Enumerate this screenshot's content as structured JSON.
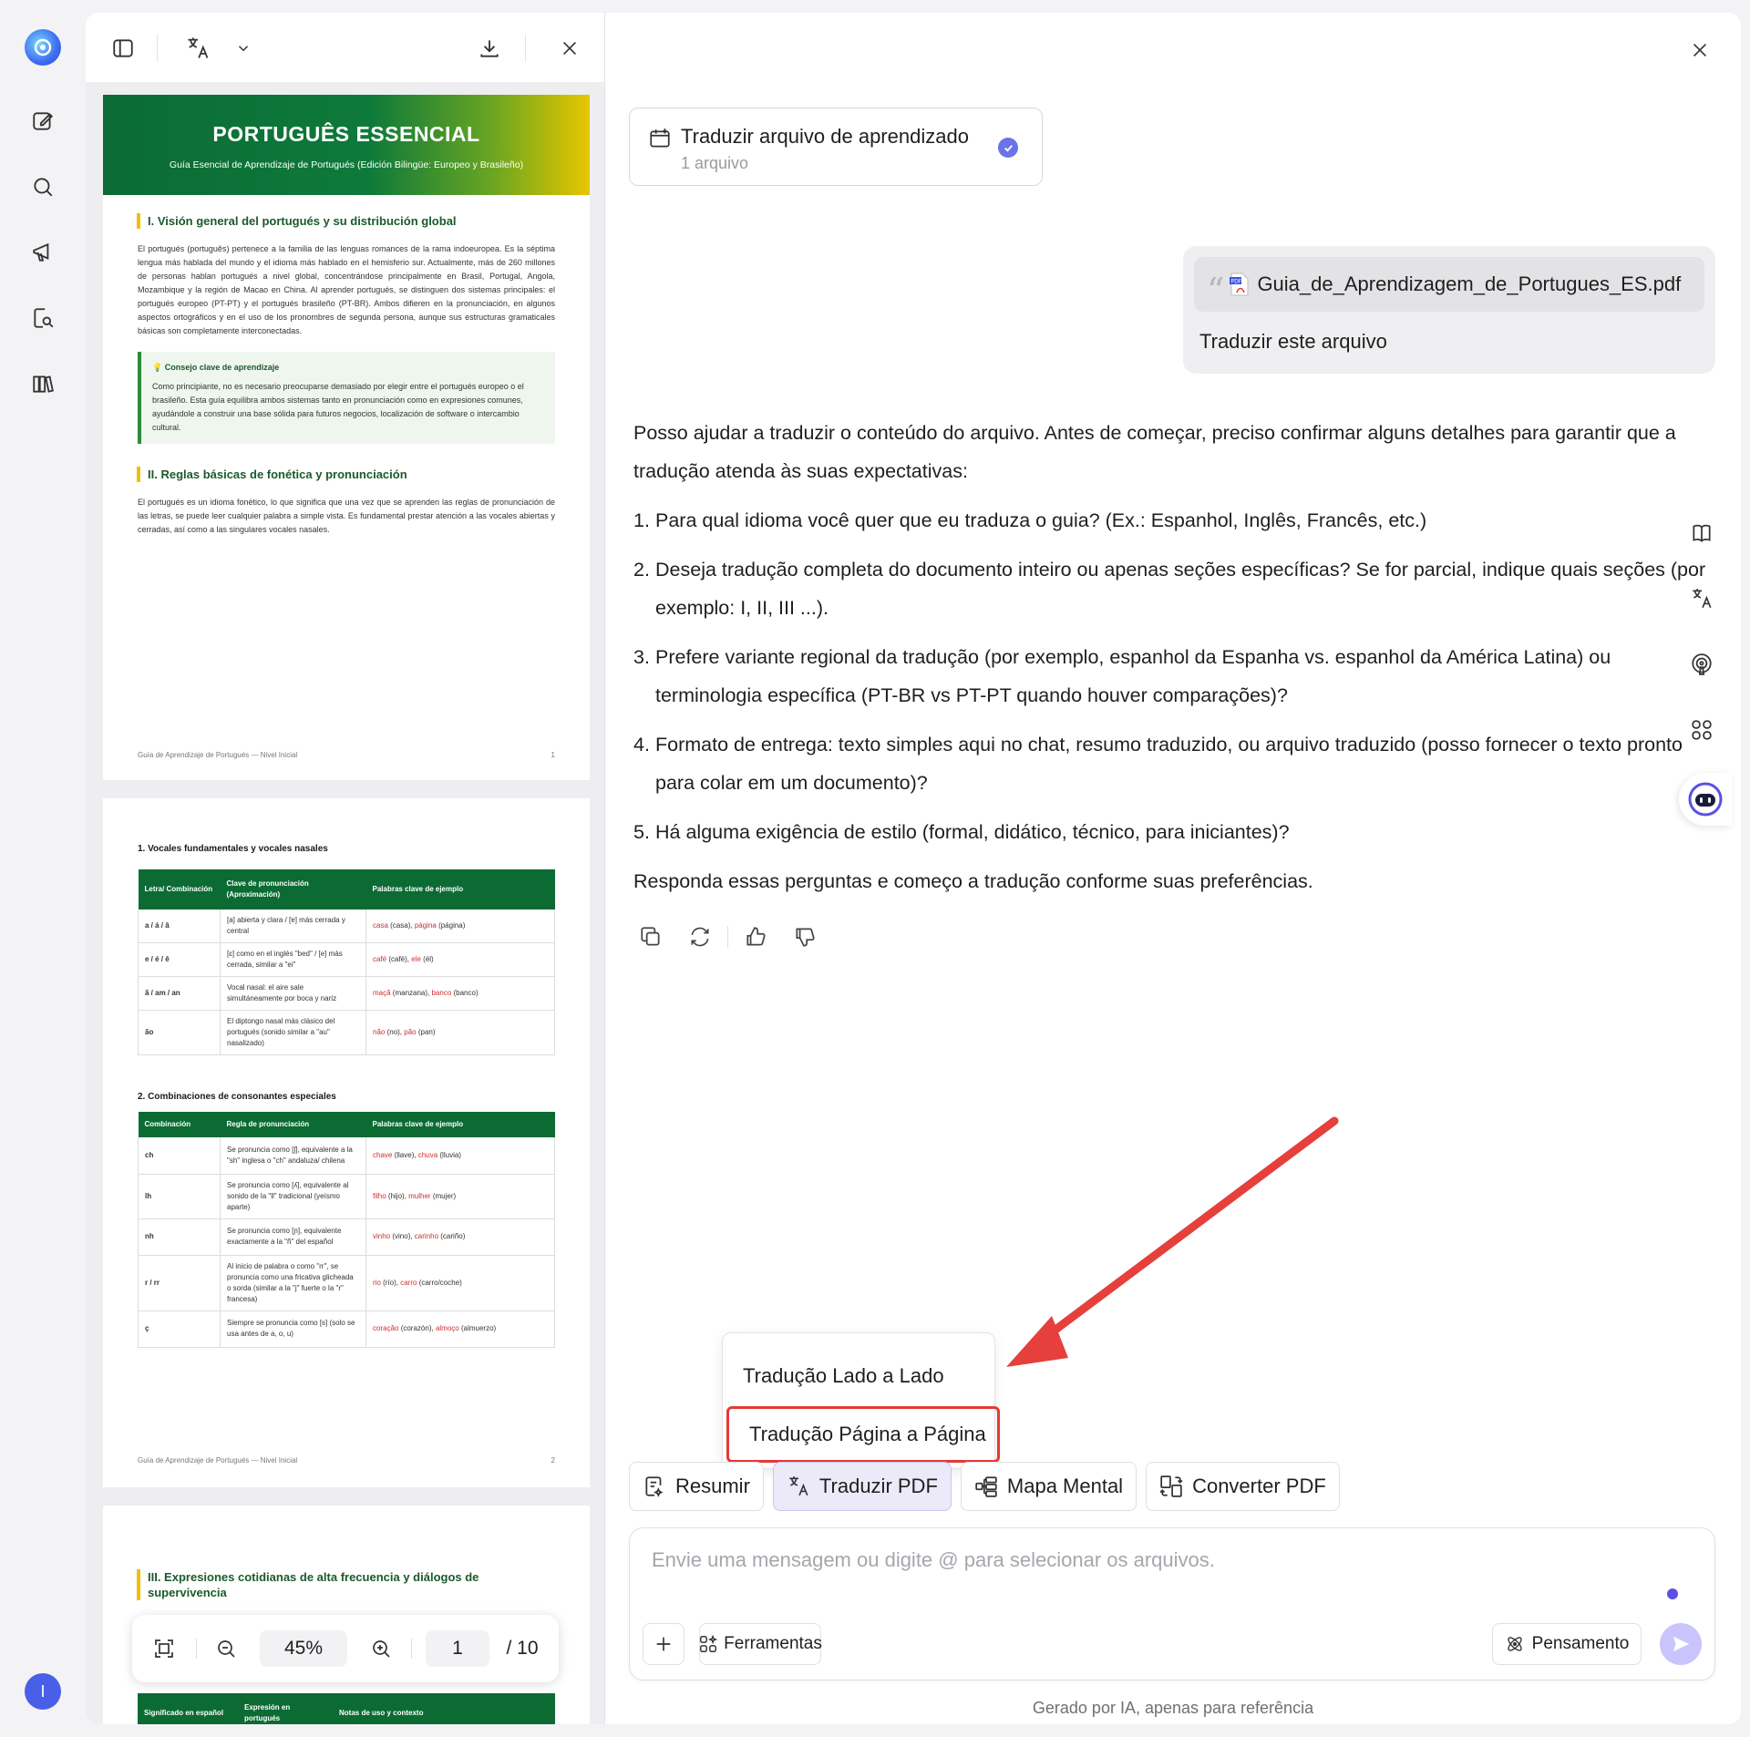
{
  "app": {
    "rail": {
      "logo_icon": "app-logo-icon",
      "items": [
        {
          "name": "new-chat",
          "icon": "edit-icon"
        },
        {
          "name": "search",
          "icon": "search-icon"
        },
        {
          "name": "presentation",
          "icon": "megaphone-icon"
        },
        {
          "name": "document-scan",
          "icon": "doc-search-icon"
        },
        {
          "name": "library",
          "icon": "books-icon"
        }
      ],
      "avatar_initial": "I"
    }
  },
  "pdf": {
    "page1": {
      "title": "PORTUGUÊS ESSENCIAL",
      "subtitle": "Guía Esencial de Aprendizaje de Portugués (Edición Bilingüe: Europeo y Brasileño)",
      "section1_title": "I. Visión general del portugués y su distribución global",
      "section1_text": "El portugués (português) pertenece a la familia de las lenguas romances de la rama indoeuropea. Es la séptima lengua más hablada del mundo y el idioma más hablado en el hemisferio sur. Actualmente, más de 260 millones de personas hablan portugués a nivel global, concentrándose principalmente en Brasil, Portugal, Angola, Mozambique y la región de Macao en China. Al aprender portugués, se distinguen dos sistemas principales: el portugués europeo (PT-PT) y el portugués brasileño (PT-BR). Ambos difieren en la pronunciación, en algunos aspectos ortográficos y en el uso de los pronombres de segunda persona, aunque sus estructuras gramaticales básicas son completamente interconectadas.",
      "tip_title": "💡 Consejo clave de aprendizaje",
      "tip_text": "Como principiante, no es necesario preocuparse demasiado por elegir entre el portugués europeo o el brasileño. Esta guía equilibra ambos sistemas tanto en pronunciación como en expresiones comunes, ayudándole a construir una base sólida para futuros negocios, localización de software o intercambio cultural.",
      "section2_title": "II. Reglas básicas de fonética y pronunciación",
      "section2_text": "El portugués es un idioma fonético, lo que significa que una vez que se aprenden las reglas de pronunciación de las letras, se puede leer cualquier palabra a simple vista. Es fundamental prestar atención a las vocales abiertas y cerradas, así como a las singulares vocales nasales.",
      "footer": "Guía de Aprendizaje de Portugués — Nivel Inicial",
      "page_number": "1"
    },
    "page2": {
      "table1_title": "1. Vocales fundamentales y vocales nasales",
      "table1_headers": [
        "Letra/ Combinación",
        "Clave de pronunciación (Aproximación)",
        "Palabras clave de ejemplo"
      ],
      "table1_rows": [
        {
          "c": "a / á / â",
          "p": "[a] abierta y clara / [ɐ] más cerrada y central",
          "e1": "casa",
          "e1t": " (casa), ",
          "e2": "página",
          "e2t": " (página)"
        },
        {
          "c": "e / é / ê",
          "p": "[ɛ] como en el inglés \"bed\" / [e] más cerrada, similar a \"ei\"",
          "e1": "café",
          "e1t": " (café), ",
          "e2": "ele",
          "e2t": " (él)"
        },
        {
          "c": "ã / am / an",
          "p": "Vocal nasal: el aire sale simultáneamente por boca y nariz",
          "e1": "maçã",
          "e1t": " (manzana), ",
          "e2": "banco",
          "e2t": " (banco)"
        },
        {
          "c": "ão",
          "p": "El diptongo nasal más clásico del portugués (sonido similar a \"au\" nasalizado)",
          "e1": "não",
          "e1t": " (no), ",
          "e2": "pão",
          "e2t": " (pan)"
        }
      ],
      "table2_title": "2. Combinaciones de consonantes especiales",
      "table2_headers": [
        "Combinación",
        "Regla de pronunciación",
        "Palabras clave de ejemplo"
      ],
      "table2_rows": [
        {
          "c": "ch",
          "p": "Se pronuncia como [ʃ], equivalente a la \"sh\" inglesa o \"ch\" andaluza/ chilena",
          "e1": "chave",
          "e1t": " (llave), ",
          "e2": "chuva",
          "e2t": " (lluvia)"
        },
        {
          "c": "lh",
          "p": "Se pronuncia como [ʎ], equivalente al sonido de la \"ll\" tradicional (yeísmo aparte)",
          "e1": "filho",
          "e1t": " (hijo), ",
          "e2": "mulher",
          "e2t": " (mujer)"
        },
        {
          "c": "nh",
          "p": "Se pronuncia como [ɲ], equivalente exactamente a la \"ñ\" del español",
          "e1": "vinho",
          "e1t": " (vino), ",
          "e2": "carinho",
          "e2t": " (cariño)"
        },
        {
          "c": "r / rr",
          "p": "Al inicio de palabra o como \"rr\", se pronuncia como una fricativa glicheada o sorda (similar a la \"j\" fuerte o la \"r\" francesa)",
          "e1": "rio",
          "e1t": " (río), ",
          "e2": "carro",
          "e2t": " (carro/coche)"
        },
        {
          "c": "ç",
          "p": "Siempre se pronuncia como [s] (solo se usa antes de a, o, u)",
          "e1": "coração",
          "e1t": " (corazón), ",
          "e2": "almoço",
          "e2t": " (almuerzo)"
        }
      ],
      "footer": "Guía de Aprendizaje de Portugués — Nivel Inicial",
      "page_number": "2"
    },
    "page3": {
      "section3_title": "III. Expresiones cotidianas de alta frecuencia y diálogos de supervivencia",
      "table_headers": [
        "Significado en español",
        "Expresión en portugués",
        "Notas de uso y contexto"
      ]
    },
    "zoom": {
      "level": "45%",
      "current_page": "1",
      "total_pages": "/ 10"
    }
  },
  "chat": {
    "task_card": {
      "title": "Traduzir arquivo de aprendizado",
      "subtitle": "1 arquivo"
    },
    "user_message": {
      "file_name": "Guia_de_Aprendizagem_de_Portugues_ES.pdf",
      "text": "Traduzir este arquivo"
    },
    "answer": {
      "intro": "Posso ajudar a traduzir o conteúdo do arquivo. Antes de começar, preciso confirmar alguns detalhes para garantir que a tradução atenda às suas expectativas:",
      "items": [
        {
          "n": "1.",
          "text": "Para qual idioma você quer que eu traduza o guia? (Ex.: Espanhol, Inglês, Francês, etc.)"
        },
        {
          "n": "2.",
          "text": "Deseja tradução completa do documento inteiro ou apenas seções específicas? Se for parcial, indique quais seções (por exemplo: I, II, III ...)."
        },
        {
          "n": "3.",
          "text": "Prefere variante regional da tradução (por exemplo, espanhol da Espanha vs. espanhol da América Latina) ou terminologia específica (PT-BR vs PT-PT quando houver comparações)?"
        },
        {
          "n": "4.",
          "text": "Formato de entrega: texto simples aqui no chat, resumo traduzido, ou arquivo traduzido (posso fornecer o texto pronto para colar em um documento)?"
        },
        {
          "n": "5.",
          "text": "Há alguma exigência de estilo (formal, didático, técnico, para iniciantes)?"
        }
      ],
      "closing": "Responda essas perguntas e começo a tradução conforme suas preferências."
    },
    "dropdown": {
      "items": [
        "Tradução Lado a Lado",
        "Tradução Página a Página"
      ]
    },
    "quick_actions": [
      {
        "label": "Resumir",
        "icon": "summary-icon"
      },
      {
        "label": "Traduzir PDF",
        "icon": "translate-icon"
      },
      {
        "label": "Mapa Mental",
        "icon": "mindmap-icon"
      },
      {
        "label": "Converter PDF",
        "icon": "convert-icon"
      }
    ],
    "composer": {
      "placeholder": "Envie uma mensagem ou digite @ para selecionar os arquivos.",
      "tools_label": "Ferramentas",
      "thinking_label": "Pensamento"
    },
    "disclaimer": "Gerado por IA, apenas para referência"
  },
  "colors": {
    "accent": "#6a73e8",
    "highlight": "#e53935",
    "pdf_green": "#0b6b33"
  }
}
